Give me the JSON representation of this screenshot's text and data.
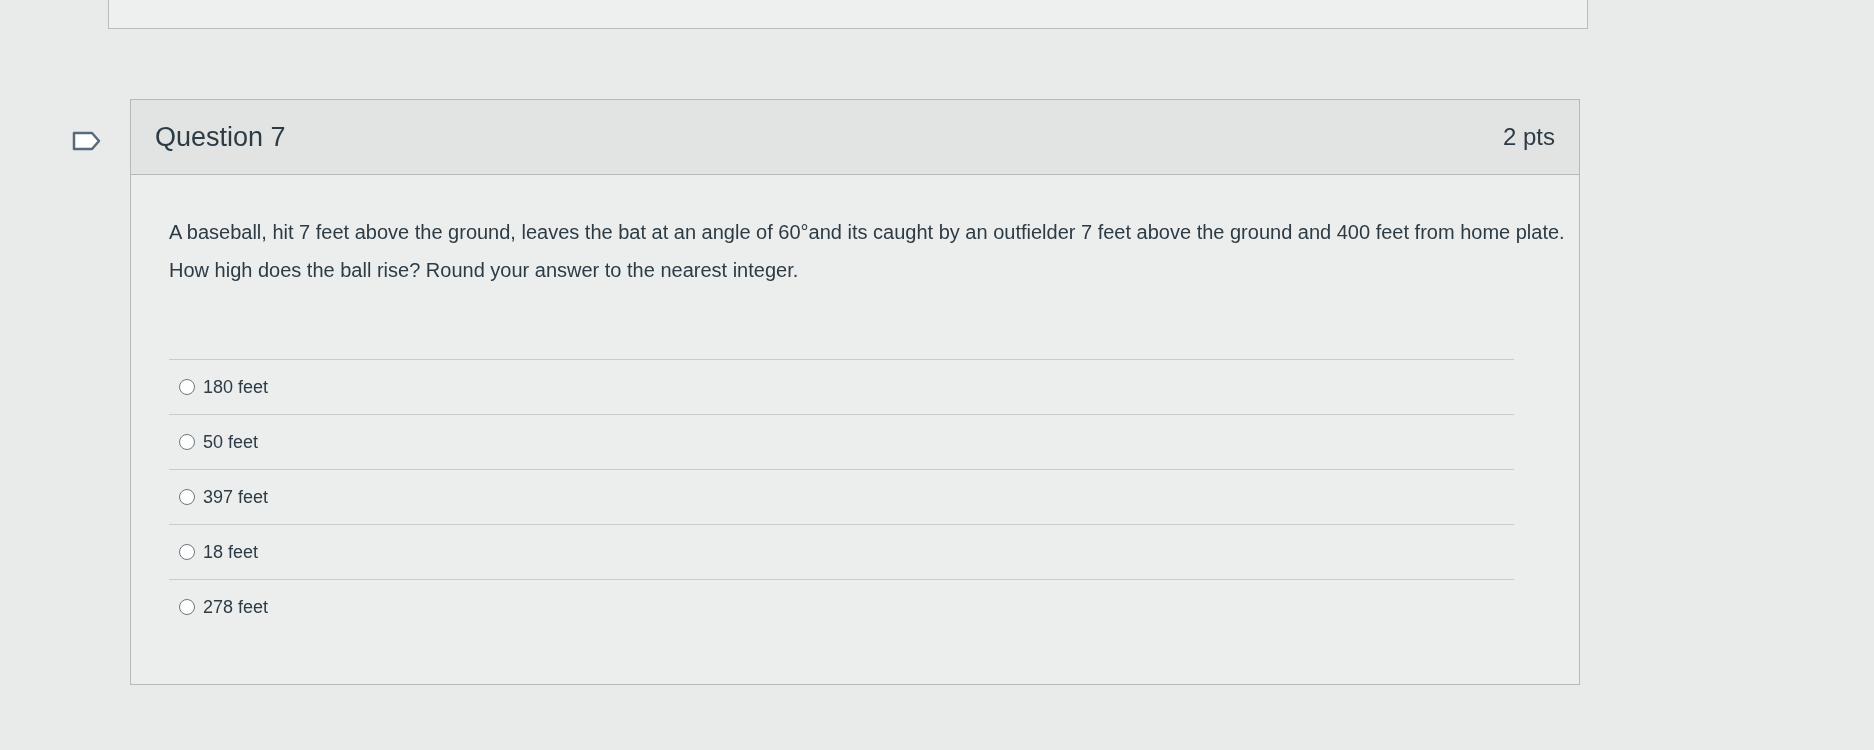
{
  "question": {
    "title": "Question 7",
    "points": "2 pts",
    "text": "A baseball, hit 7 feet above the ground, leaves the bat at an angle of 60°and its caught by an outfielder 7 feet above the ground and 400 feet from home plate. How high does the ball rise? Round your answer to the nearest integer.",
    "answers": [
      {
        "label": "180 feet",
        "selected": false
      },
      {
        "label": "50 feet",
        "selected": false
      },
      {
        "label": "397 feet",
        "selected": false
      },
      {
        "label": "18 feet",
        "selected": false
      },
      {
        "label": "278 feet",
        "selected": false
      }
    ]
  }
}
